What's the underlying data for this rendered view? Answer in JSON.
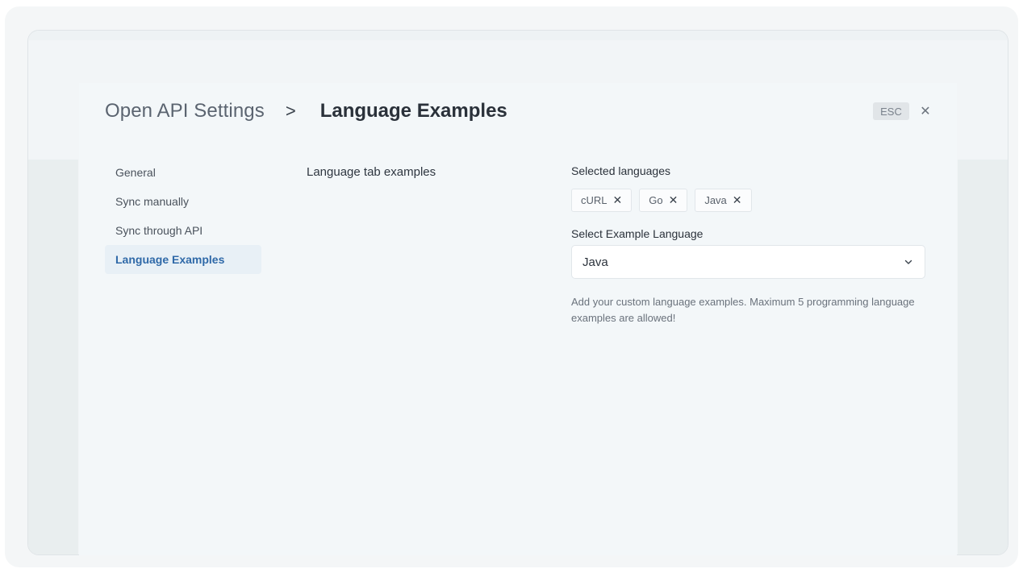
{
  "header": {
    "breadcrumb_parent": "Open API Settings",
    "breadcrumb_separator": ">",
    "breadcrumb_current": "Language Examples",
    "esc_label": "ESC",
    "close_glyph": "✕"
  },
  "sidebar": {
    "items": [
      {
        "label": "General",
        "active": false
      },
      {
        "label": "Sync manually",
        "active": false
      },
      {
        "label": "Sync through API",
        "active": false
      },
      {
        "label": "Language Examples",
        "active": true
      }
    ]
  },
  "main": {
    "section_label": "Language tab examples",
    "selected_languages_label": "Selected languages",
    "selected_languages": [
      {
        "label": "cURL",
        "remove_glyph": "✕"
      },
      {
        "label": "Go",
        "remove_glyph": "✕"
      },
      {
        "label": "Java",
        "remove_glyph": "✕"
      }
    ],
    "select_label": "Select Example Language",
    "select_value": "Java",
    "select_icon": "chevron-down-icon",
    "help_text": "Add your custom language examples. Maximum 5 programming language examples are allowed!"
  },
  "colors": {
    "accent": "#2f69a8",
    "active_bg": "#e8f0f6",
    "panel_bg": "#f3f7f9"
  }
}
